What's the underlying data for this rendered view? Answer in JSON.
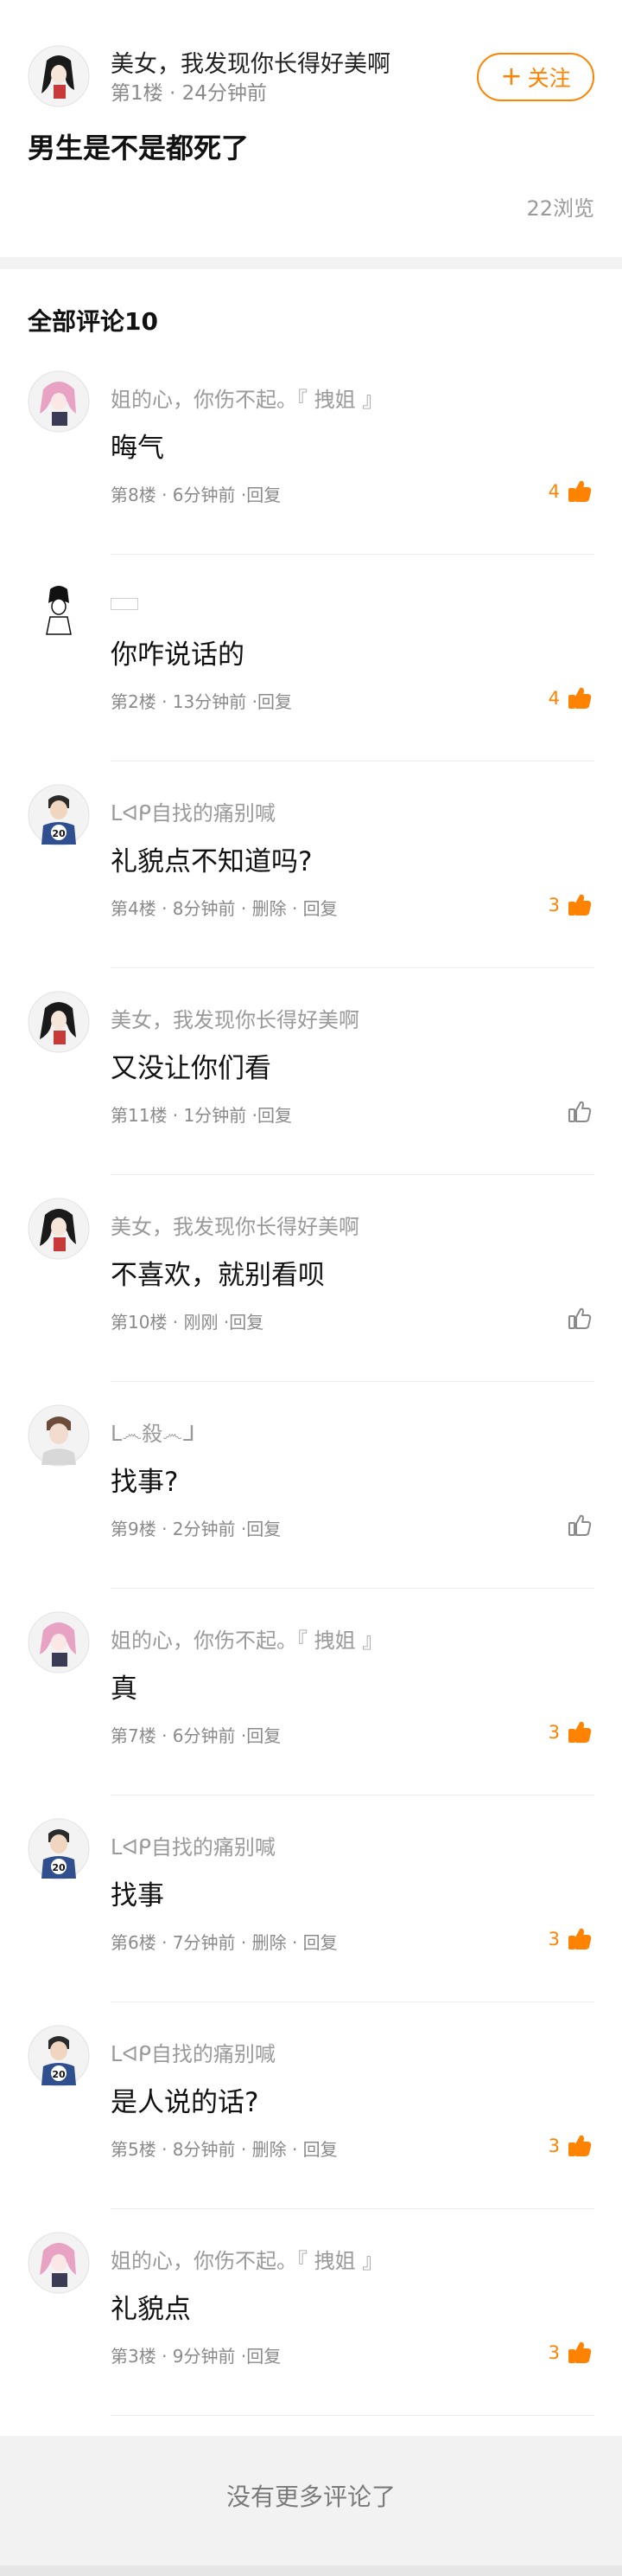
{
  "post": {
    "author": "美女，我发现你长得好美啊",
    "meta": "第1楼 · 24分钟前",
    "follow_label": "关注",
    "content": "男生是不是都死了",
    "views": "22浏览"
  },
  "comments_header": "全部评论10",
  "comments": [
    {
      "name": "姐的心，你伤不起。『 拽姐 』",
      "text": "晦气",
      "meta": "第8楼 · 6分钟前 ·回复",
      "likes": "4",
      "avatar": "pink-hair-avatar"
    },
    {
      "name": "",
      "text": "你咋说话的",
      "meta": "第2楼 · 13分钟前 ·回复",
      "likes": "4",
      "avatar": "sketch-avatar"
    },
    {
      "name": "ᒪᐊᑭ自找的痛别喊",
      "text": "礼貌点不知道吗?",
      "meta": "第4楼 · 8分钟前 · 删除 · 回复",
      "likes": "3",
      "avatar": "jersey-20-avatar"
    },
    {
      "name": "美女，我发现你长得好美啊",
      "text": "又没让你们看",
      "meta": "第11楼 · 1分钟前 ·回复",
      "likes": "",
      "avatar": "girl-avatar"
    },
    {
      "name": "美女，我发现你长得好美啊",
      "text": "不喜欢，就别看呗",
      "meta": "第10楼 · 刚刚 ·回复",
      "likes": "",
      "avatar": "girl-avatar"
    },
    {
      "name": "ᒪ෴殺෴ᒧ",
      "text": "找事?",
      "meta": "第9楼 · 2分钟前 ·回复",
      "likes": "",
      "avatar": "guy-avatar"
    },
    {
      "name": "姐的心，你伤不起。『 拽姐 』",
      "text": "真",
      "meta": "第7楼 · 6分钟前 ·回复",
      "likes": "3",
      "avatar": "pink-hair-avatar"
    },
    {
      "name": "ᒪᐊᑭ自找的痛别喊",
      "text": "找事",
      "meta": "第6楼 · 7分钟前 · 删除 · 回复",
      "likes": "3",
      "avatar": "jersey-20-avatar"
    },
    {
      "name": "ᒪᐊᑭ自找的痛别喊",
      "text": "是人说的话?",
      "meta": "第5楼 · 8分钟前 · 删除 · 回复",
      "likes": "3",
      "avatar": "jersey-20-avatar"
    },
    {
      "name": "姐的心，你伤不起。『 拽姐 』",
      "text": "礼貌点",
      "meta": "第3楼 · 9分钟前 ·回复",
      "likes": "3",
      "avatar": "pink-hair-avatar"
    }
  ],
  "footer_text": "没有更多评论了",
  "colors": {
    "accent": "#ff8200",
    "muted": "#9a9a9a",
    "band": "#f2f2f2"
  }
}
